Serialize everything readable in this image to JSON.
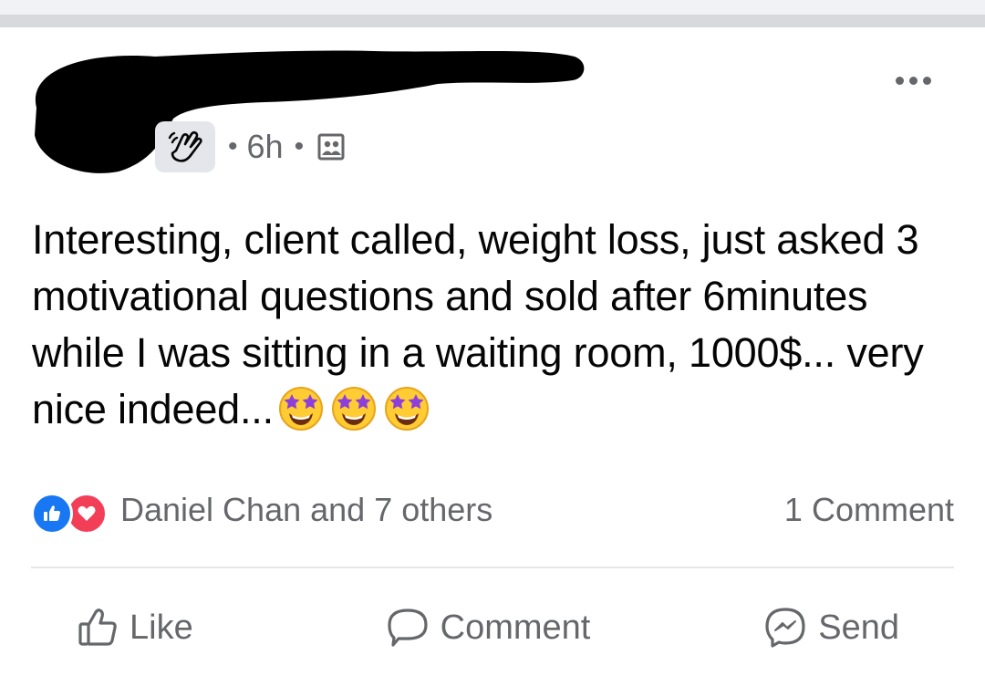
{
  "post": {
    "meta": {
      "time": "6h",
      "separator": "•",
      "badge_icon": "waving-hand-icon",
      "audience_icon": "friends-audience-icon"
    },
    "more_icon": "more-options-icon",
    "text": "Interesting, client called, weight loss, just asked 3 motivational questions and sold after 6minutes while I was sitting in a waiting room, 1000$... very nice indeed...",
    "emoji": [
      "star-struck-emoji",
      "star-struck-emoji",
      "star-struck-emoji"
    ]
  },
  "reactions": {
    "icons": [
      "like-reaction-icon",
      "love-reaction-icon"
    ],
    "summary": "Daniel Chan and 7 others",
    "comment_count": "1 Comment"
  },
  "actions": {
    "like_label": "Like",
    "comment_label": "Comment",
    "send_label": "Send"
  },
  "colors": {
    "secondary_text": "#65676b",
    "like_blue": "#1877f2",
    "love_red": "#f33e58",
    "badge_gray": "#e4e6eb"
  }
}
